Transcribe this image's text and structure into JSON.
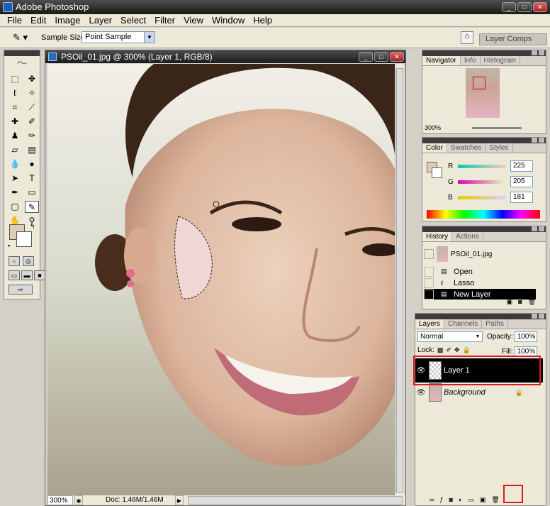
{
  "app": {
    "title": "Adobe Photoshop"
  },
  "menu": [
    "File",
    "Edit",
    "Image",
    "Layer",
    "Select",
    "Filter",
    "View",
    "Window",
    "Help"
  ],
  "options": {
    "sample_size_label": "Sample Size:",
    "sample_size_value": "Point Sample",
    "layer_comps_tab": "Layer Comps"
  },
  "document": {
    "title": "PSOil_01.jpg @ 300% (Layer 1, RGB/8)",
    "zoom": "300%",
    "doc_size": "Doc: 1.46M/1.46M"
  },
  "navigator": {
    "tabs": [
      "Navigator",
      "Info",
      "Histogram"
    ],
    "zoom": "300%"
  },
  "color": {
    "tabs": [
      "Color",
      "Swatches",
      "Styles"
    ],
    "r": {
      "label": "R",
      "value": "225"
    },
    "g": {
      "label": "G",
      "value": "205"
    },
    "b": {
      "label": "B",
      "value": "181"
    },
    "foreground": "#e1cdb5"
  },
  "history": {
    "tabs": [
      "History",
      "Actions"
    ],
    "snapshot": "PSOil_01.jpg",
    "items": [
      "Open",
      "Lasso",
      "New Layer"
    ]
  },
  "layers": {
    "tabs": [
      "Layers",
      "Channels",
      "Paths"
    ],
    "blend_mode": "Normal",
    "opacity_label": "Opacity:",
    "opacity": "100%",
    "lock_label": "Lock:",
    "fill_label": "Fill:",
    "fill": "100%",
    "items": [
      {
        "name": "Layer 1",
        "selected": true
      },
      {
        "name": "Background",
        "selected": false
      }
    ]
  }
}
